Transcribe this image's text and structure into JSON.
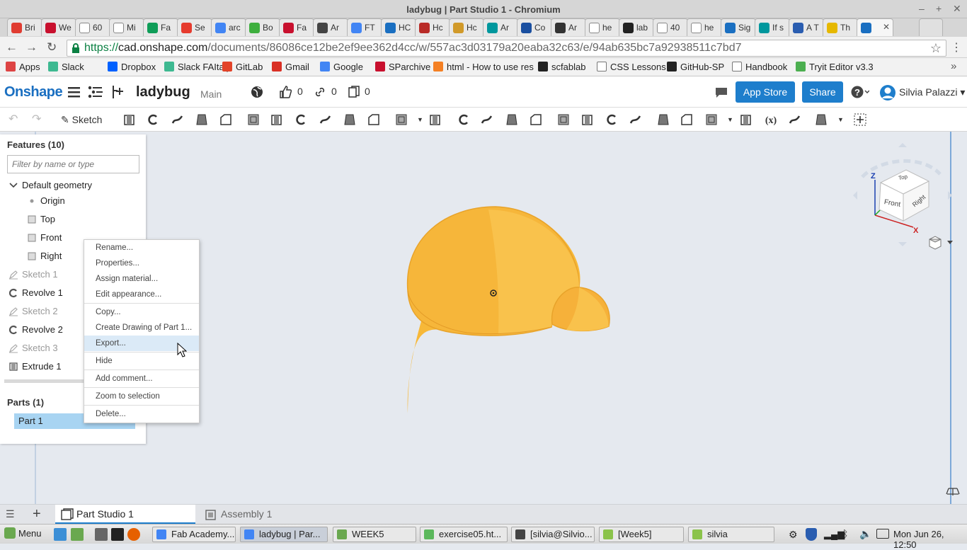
{
  "window": {
    "title": "ladybug | Part Studio 1 - Chromium"
  },
  "browser_tabs": [
    {
      "label": "Bri",
      "icon": "tab-favicon",
      "color": "#e03c31"
    },
    {
      "label": "We",
      "icon": "tab-favicon",
      "color": "#c8102e"
    },
    {
      "label": "60",
      "icon": "page-icon",
      "color": "#ffffff"
    },
    {
      "label": "Mi",
      "icon": "page-icon",
      "color": "#ffffff"
    },
    {
      "label": "Fa",
      "icon": "sheets-icon",
      "color": "#0f9d58"
    },
    {
      "label": "Se",
      "icon": "tab-favicon",
      "color": "#e63b2e"
    },
    {
      "label": "arc",
      "icon": "google-icon",
      "color": "#4285f4"
    },
    {
      "label": "Bo",
      "icon": "tab-favicon",
      "color": "#3eaf3e"
    },
    {
      "label": "Fa",
      "icon": "tab-favicon",
      "color": "#c8102e"
    },
    {
      "label": "Ar",
      "icon": "tab-favicon",
      "color": "#444444"
    },
    {
      "label": "FT",
      "icon": "google-icon",
      "color": "#4285f4"
    },
    {
      "label": "HC",
      "icon": "tab-favicon",
      "color": "#1a6fc1"
    },
    {
      "label": "Hc",
      "icon": "tab-favicon",
      "color": "#b92b27"
    },
    {
      "label": "Hc",
      "icon": "tab-favicon",
      "color": "#d19a2a"
    },
    {
      "label": "Ar",
      "icon": "tab-favicon",
      "color": "#00979d"
    },
    {
      "label": "Co",
      "icon": "tab-favicon",
      "color": "#1a4fa0"
    },
    {
      "label": "Ar",
      "icon": "tab-favicon",
      "color": "#333333"
    },
    {
      "label": "he",
      "icon": "page-icon",
      "color": "#ffffff"
    },
    {
      "label": "lab",
      "icon": "github-icon",
      "color": "#222222"
    },
    {
      "label": "40",
      "icon": "page-icon",
      "color": "#ffffff"
    },
    {
      "label": "he",
      "icon": "page-icon",
      "color": "#ffffff"
    },
    {
      "label": "Sig",
      "icon": "onshape-icon",
      "color": "#1a6fc1"
    },
    {
      "label": "If s",
      "icon": "tab-favicon",
      "color": "#00979d"
    },
    {
      "label": "A T",
      "icon": "tab-favicon",
      "color": "#2a5db0"
    },
    {
      "label": "Th",
      "icon": "tab-favicon",
      "color": "#e6b800"
    },
    {
      "label": "",
      "icon": "onshape-icon",
      "color": "#1a6fc1"
    }
  ],
  "address_bar": {
    "url_scheme": "https://",
    "url_host": "cad.onshape.com",
    "url_path": "/documents/86086ce12be2ef9ee362d4cc/w/557ac3d03179a20eaba32c63/e/94ab635bc7a92938511c7bd7"
  },
  "bookmarks": [
    {
      "label": "Apps",
      "color": "#d44"
    },
    {
      "label": "Slack",
      "color": "#3eb991"
    },
    {
      "label": "Dropbox",
      "color": "#0061ff"
    },
    {
      "label": "Slack FAItaly",
      "color": "#3eb991"
    },
    {
      "label": "GitLab",
      "color": "#e24329"
    },
    {
      "label": "Gmail",
      "color": "#d93025"
    },
    {
      "label": "Google",
      "color": "#4285f4"
    },
    {
      "label": "SParchive",
      "color": "#c8102e"
    },
    {
      "label": "html - How to use res",
      "color": "#f48024"
    },
    {
      "label": "scfablab",
      "color": "#222222"
    },
    {
      "label": "CSS Lessons",
      "color": "#ffffff"
    },
    {
      "label": "GitHub-SP",
      "color": "#222222"
    },
    {
      "label": "Handbook",
      "color": "#ffffff"
    },
    {
      "label": "Tryit Editor v3.3",
      "color": "#4caf50"
    }
  ],
  "onshape": {
    "logo": "Onshape",
    "document_name": "ladybug",
    "branch": "Main",
    "likes": "0",
    "links": "0",
    "copies": "0",
    "app_store": "App Store",
    "share": "Share",
    "user": "Silvia Palazzi"
  },
  "toolbar": {
    "sketch": "Sketch"
  },
  "features": {
    "header": "Features (10)",
    "filter_placeholder": "Filter by name or type",
    "items": [
      {
        "label": "Default geometry",
        "icon": "chevron-down-icon",
        "dim": false
      },
      {
        "label": "Origin",
        "icon": "origin-icon",
        "dim": false
      },
      {
        "label": "Top",
        "icon": "plane-icon",
        "dim": false
      },
      {
        "label": "Front",
        "icon": "plane-icon",
        "dim": false
      },
      {
        "label": "Right",
        "icon": "plane-icon",
        "dim": false
      },
      {
        "label": "Sketch 1",
        "icon": "sketch-icon",
        "dim": true
      },
      {
        "label": "Revolve 1",
        "icon": "revolve-icon",
        "dim": false
      },
      {
        "label": "Sketch 2",
        "icon": "sketch-icon",
        "dim": true
      },
      {
        "label": "Revolve 2",
        "icon": "revolve-icon",
        "dim": false
      },
      {
        "label": "Sketch 3",
        "icon": "sketch-icon",
        "dim": true
      },
      {
        "label": "Extrude 1",
        "icon": "extrude-icon",
        "dim": false
      }
    ]
  },
  "parts": {
    "header": "Parts (1)",
    "items": [
      "Part 1"
    ]
  },
  "context_menu": {
    "items": [
      "Rename...",
      "Properties...",
      "Assign material...",
      "Edit appearance...",
      "Copy...",
      "Create Drawing of Part 1...",
      "Export...",
      "Hide",
      "Add comment...",
      "Zoom to selection",
      "Delete..."
    ],
    "highlighted": "Export..."
  },
  "view_cube": {
    "top": "Top",
    "front": "Front",
    "right": "Right",
    "axis_z": "Z",
    "axis_x": "X"
  },
  "model_color": "#f7b838",
  "bottom_tabs": [
    {
      "label": "Part Studio 1",
      "active": true
    },
    {
      "label": "Assembly 1",
      "active": false
    }
  ],
  "taskbar": {
    "menu": "Menu",
    "tasks": [
      {
        "label": "Fab Academy...",
        "color": "#4285f4"
      },
      {
        "label": "ladybug | Par...",
        "color": "#4285f4"
      },
      {
        "label": "WEEK5",
        "color": "#6aa84f"
      },
      {
        "label": "exercise05.ht...",
        "color": "#5cb85c"
      },
      {
        "label": "[silvia@Silvio...",
        "color": "#444"
      },
      {
        "label": "[Week5]",
        "color": "#8bc34a"
      },
      {
        "label": "silvia",
        "color": "#8bc34a"
      }
    ],
    "clock": "Mon Jun 26, 12:50"
  }
}
